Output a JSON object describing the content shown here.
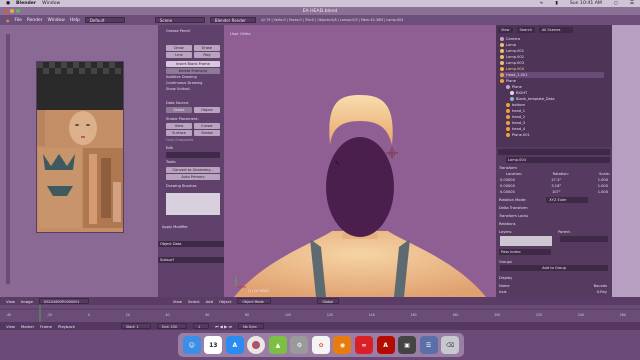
{
  "mac_menu": {
    "app": "Blender",
    "window": "Window",
    "clock": "Sun 10:41 AM"
  },
  "window": {
    "title": "EA HEAD.blend"
  },
  "info_bar": {
    "menus": [
      "File",
      "Render",
      "Window",
      "Help"
    ],
    "layout": "Default",
    "scene": "Scene",
    "engine": "Blender Render",
    "stats": "v2.79 | Verts:0 | Faces:0 | Tris:0 | Objects:0/8 | Lamps:0/3 | Mem:42.36M | Lamp.004"
  },
  "tool_panel": {
    "header": "Grease Pencil",
    "buttons": [
      "Draw",
      "Erase",
      "Line",
      "Poly"
    ],
    "insert": "Insert Blank Frame",
    "delete": "Delete Frame(s)",
    "checks": [
      "Additive Drawing",
      "Continuous Drawing",
      "Show Unitvol."
    ],
    "data_source": "Data Source:",
    "scene": "Scene",
    "object": "Object",
    "stroke_placement": "Stroke Placement:",
    "view": "View",
    "cursor": "Cursor",
    "surface": "Surface",
    "stroke": "Stroke",
    "only_endpoints": "Only Endpoints",
    "edit": "Edit",
    "convert": "Convert to Geometry...",
    "auto_primary": "Auto Primary",
    "drawing_brushes": "Drawing Brushes",
    "apply_modifier": "Apply Modifier",
    "object_data": "Object Data",
    "subsurf": "Subsurf"
  },
  "viewport": {
    "label": "User Ortho",
    "corner": "(1) EA HEAD",
    "mode": "Object Mode",
    "orientation": "Global"
  },
  "outliner": {
    "menus": [
      "View",
      "Search",
      "All Scenes"
    ],
    "rows": [
      "Camera",
      "Lamp",
      "Lamp.001",
      "Lamp.002",
      "Lamp.003",
      "Lamp.004",
      "Head_1.001",
      "Plane",
      "Plane",
      "RIGHT",
      "Blank_template_Data",
      "bottom",
      "head_1",
      "head_2",
      "head_3",
      "head_4",
      "Plane.001"
    ]
  },
  "properties": {
    "object_name": "Lamp.004",
    "transform": "Transform",
    "location": "Location:",
    "rotation": "Rotation:",
    "scale": "Scale:",
    "loc_vals": [
      "0.00000",
      "0.00000",
      "0.00000"
    ],
    "rot_vals": [
      "27.3°",
      "3.16°",
      "107°"
    ],
    "scale_vals": [
      "1.000",
      "1.000",
      "1.000"
    ],
    "rotation_mode": "Rotation Mode:",
    "rotation_mode_val": "XYZ Euler",
    "delta": "Delta Transform",
    "transform_locks": "Transform Locks",
    "relations": "Relations",
    "layers": "Layers:",
    "parent": "Parent:",
    "pass_index": "Pass Index:",
    "groups": "Groups",
    "add_to_group": "Add to Group",
    "display": "Display",
    "name": "Name",
    "bounds": "Bounds",
    "axis": "Axis",
    "x_ray": "X-Ray"
  },
  "image_header": {
    "menus": [
      "View",
      "Image"
    ],
    "image_name": "DSC04600P.0000001"
  },
  "viewport_header": {
    "menus": [
      "View",
      "Select",
      "Add",
      "Object"
    ]
  },
  "timeline": {
    "menus": [
      "View",
      "Marker",
      "Frame",
      "Playback"
    ],
    "start_label": "Start:",
    "start": "1",
    "end_label": "End:",
    "end": "250",
    "frame": "1",
    "sync": "No Sync",
    "ticks": [
      "-40",
      "-20",
      "0",
      "20",
      "40",
      "60",
      "80",
      "100",
      "120",
      "140",
      "160",
      "180",
      "200",
      "220",
      "240",
      "260"
    ]
  },
  "dock": {
    "items": [
      "Finder",
      "Calendar",
      "App Store",
      "Chrome",
      "Android",
      "Settings",
      "Photos",
      "Blender",
      "Creative Cloud",
      "Acrobat",
      "Screenshot",
      "Notes",
      "Trash"
    ],
    "calendar_day": "13"
  },
  "colors": {
    "accent": "#d9a060",
    "panel": "#5f416c",
    "viewport": "#8f5f93"
  }
}
